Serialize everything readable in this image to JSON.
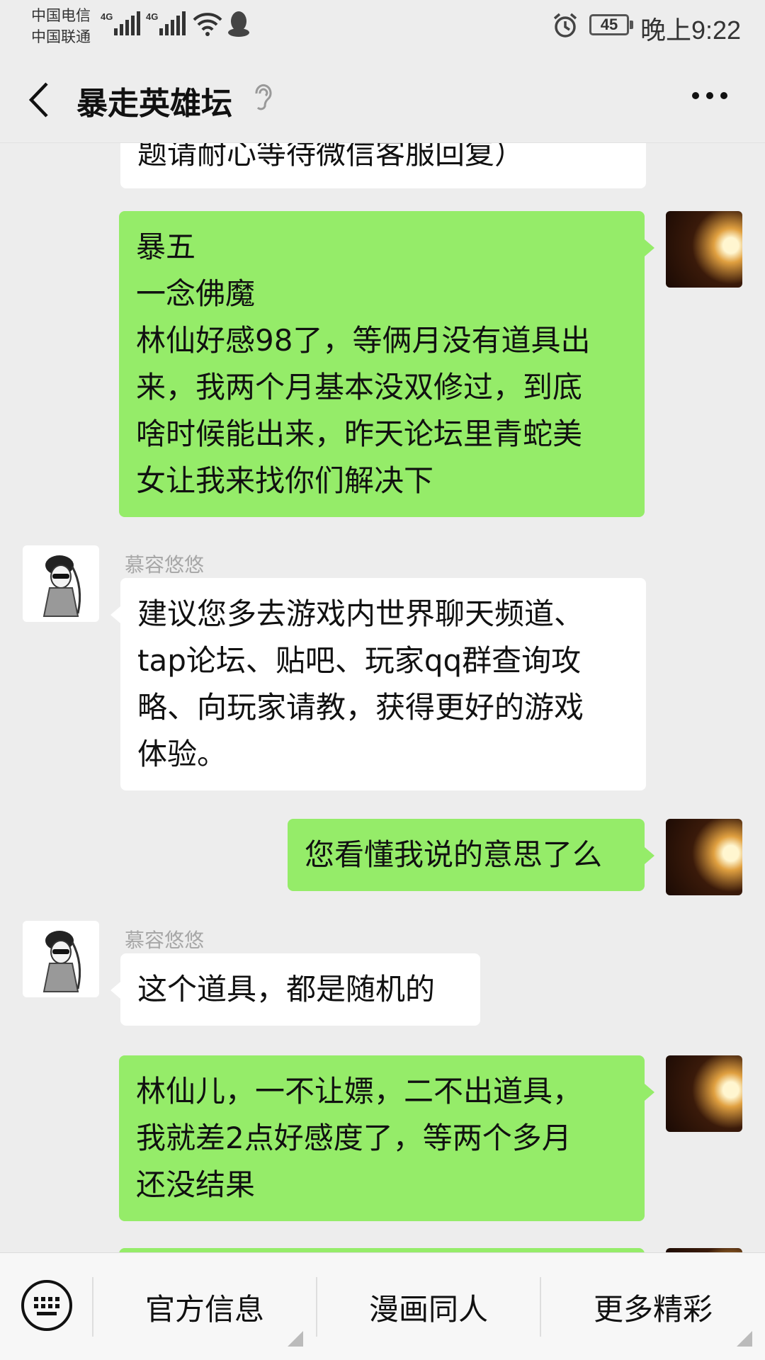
{
  "status_bar": {
    "carrier_1": "中国电信",
    "carrier_2": "中国联通",
    "network_1": "4G",
    "network_2": "4G",
    "battery": "45",
    "time": "晚上9:22"
  },
  "header": {
    "title": "暴走英雄坛"
  },
  "messages": [
    {
      "from": "cs",
      "lines": [
        "题请耐心等待微信客服回复）"
      ]
    },
    {
      "from": "me",
      "lines": [
        "暴五",
        "一念佛魔",
        "林仙好感98了，等俩月没有道具出",
        "来，我两个月基本没双修过，到底",
        "啥时候能出来，昨天论坛里青蛇美",
        "女让我来找你们解决下"
      ]
    },
    {
      "from": "cs",
      "sender": "慕容悠悠",
      "lines": [
        "建议您多去游戏内世界聊天频道、",
        "tap论坛、贴吧、玩家qq群查询攻",
        "略、向玩家请教，获得更好的游戏",
        "体验。"
      ]
    },
    {
      "from": "me",
      "lines": [
        "您看懂我说的意思了么"
      ]
    },
    {
      "from": "cs",
      "sender": "慕容悠悠",
      "lines": [
        "这个道具，都是随机的"
      ]
    },
    {
      "from": "me",
      "lines": [
        "林仙儿，一不让嫖，二不出道具，",
        "我就差2点好感度了，等两个多月",
        "还没结果"
      ]
    }
  ],
  "bottom_menu": {
    "items": [
      "官方信息",
      "漫画同人",
      "更多精彩"
    ]
  },
  "colors": {
    "background": "#ededed",
    "outgoing_bubble": "#95ec69",
    "incoming_bubble": "#ffffff"
  },
  "icons": [
    "back-arrow-icon",
    "ear-icon",
    "more-icon",
    "keyboard-icon",
    "alarm-icon",
    "wifi-icon",
    "qq-icon",
    "signal-icon"
  ]
}
